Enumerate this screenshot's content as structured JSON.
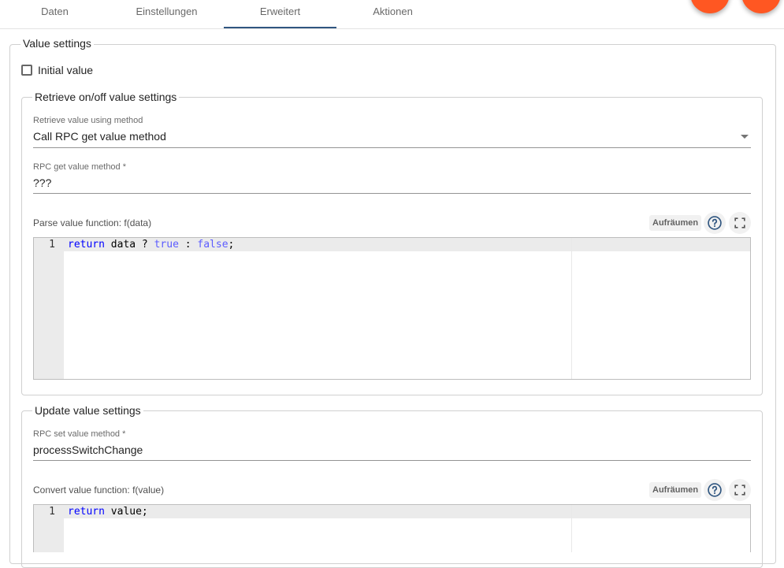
{
  "tabs": [
    {
      "label": "Daten"
    },
    {
      "label": "Einstellungen"
    },
    {
      "label": "Erweitert"
    },
    {
      "label": "Aktionen"
    }
  ],
  "active_tab": "Erweitert",
  "accent_color": "#305680",
  "fab_color": "#ff5722",
  "value_settings": {
    "legend": "Value settings",
    "initial_value_label": "Initial value",
    "initial_value_checked": false
  },
  "retrieve": {
    "legend": "Retrieve on/off value settings",
    "method_label": "Retrieve value using method",
    "method_value": "Call RPC get value method",
    "rpc_label": "RPC get value method *",
    "rpc_value": "???",
    "parse_title": "Parse value function: f(data)",
    "tidy_label": "Aufräumen",
    "code_line_number": "1",
    "code": {
      "kw_return": "return",
      "t1": " data ? ",
      "bool_true": "true",
      "t2": " : ",
      "bool_false": "false",
      "t3": ";"
    }
  },
  "update": {
    "legend": "Update value settings",
    "rpc_label": "RPC set value method *",
    "rpc_value": "processSwitchChange",
    "convert_title": "Convert value function: f(value)",
    "tidy_label": "Aufräumen",
    "code_line_number": "1",
    "code": {
      "kw_return": "return",
      "t1": " value;"
    }
  },
  "icons": [
    "help-icon",
    "fullscreen-icon"
  ]
}
